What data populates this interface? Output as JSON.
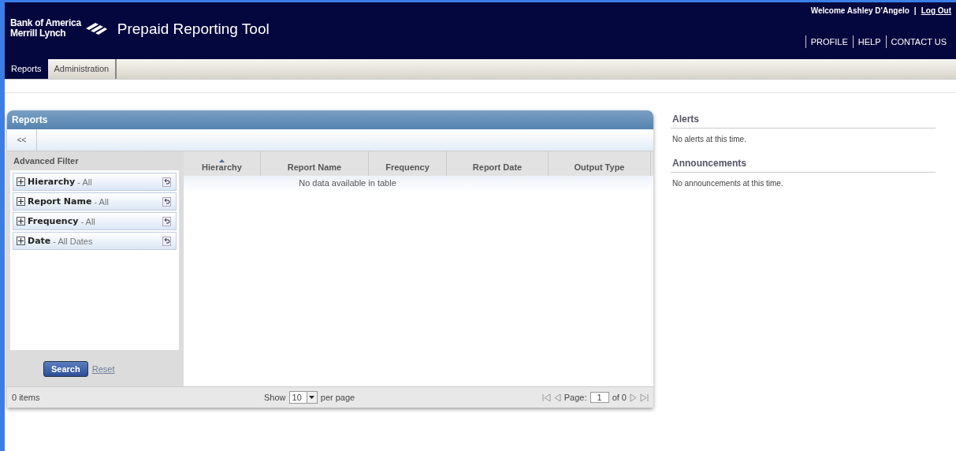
{
  "header": {
    "logo_line1": "Bank of America",
    "logo_line2": "Merrill Lynch",
    "app_title": "Prepaid Reporting Tool",
    "welcome": "Welcome Ashley D'Angelo",
    "separator": "|",
    "logout": "Log Out",
    "nav_links": [
      "PROFILE",
      "HELP",
      "CONTACT US"
    ]
  },
  "tabs": [
    {
      "label": "Reports",
      "selected": true
    },
    {
      "label": "Administration",
      "selected": false
    }
  ],
  "reports": {
    "title": "Reports",
    "collapse_button": "<<",
    "filter": {
      "title": "Advanced Filter",
      "items": [
        {
          "name": "Hierarchy",
          "value": "- All"
        },
        {
          "name": "Report Name",
          "value": "- All"
        },
        {
          "name": "Frequency",
          "value": "- All"
        },
        {
          "name": "Date",
          "value": "- All Dates"
        }
      ],
      "search": "Search",
      "reset": "Reset"
    },
    "table": {
      "columns": [
        {
          "label": "Hierarchy",
          "sorted": true
        },
        {
          "label": "Report Name",
          "sorted": false
        },
        {
          "label": "Frequency",
          "sorted": false
        },
        {
          "label": "Report Date",
          "sorted": false
        },
        {
          "label": "Output Type",
          "sorted": false
        }
      ],
      "empty_message": "No data available in table"
    },
    "footer": {
      "items_count": "0 items",
      "show": "Show",
      "per_page_value": "10",
      "per_page": "per page",
      "page_label": "Page:",
      "page_value": "1",
      "of": "of 0"
    }
  },
  "alerts": {
    "title": "Alerts",
    "message": "No alerts at this time."
  },
  "announcements": {
    "title": "Announcements",
    "message": "No announcements at this time."
  }
}
